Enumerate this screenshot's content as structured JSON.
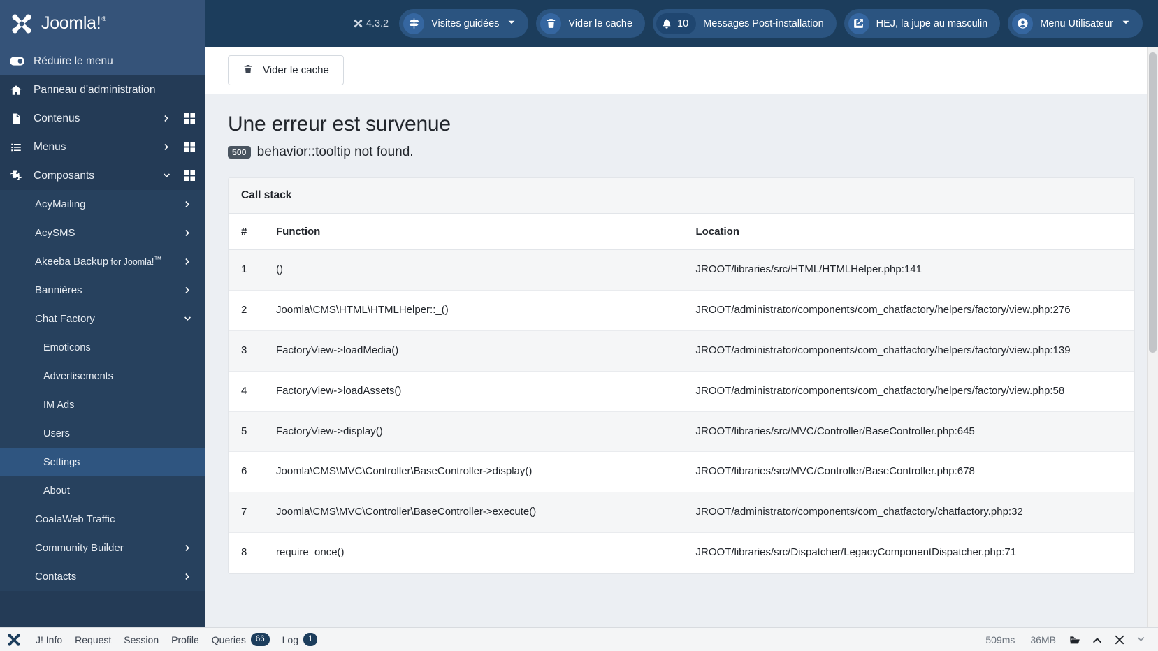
{
  "header": {
    "brand": "Joomla!",
    "brand_tm": "®",
    "version": "4.3.2",
    "buttons": {
      "guided_tours": "Visites guidées",
      "clear_cache": "Vider le cache",
      "post_install": "Messages Post-installation",
      "notifications_count": "10",
      "site_name": "HEJ, la jupe au masculin",
      "user_menu": "Menu Utilisateur"
    }
  },
  "sidebar": {
    "collapse": "Réduire le menu",
    "items": [
      {
        "label": "Panneau d'administration",
        "icon": "home-icon",
        "level": 0,
        "arrow": false,
        "grid": false,
        "active": false
      },
      {
        "label": "Contenus",
        "icon": "document-icon",
        "level": 0,
        "arrow": "right",
        "grid": true,
        "active": false
      },
      {
        "label": "Menus",
        "icon": "list-icon",
        "level": 0,
        "arrow": "right",
        "grid": true,
        "active": false
      },
      {
        "label": "Composants",
        "icon": "puzzle-icon",
        "level": 0,
        "arrow": "down",
        "grid": true,
        "active": false
      },
      {
        "label": "AcyMailing",
        "level": 1,
        "arrow": "right",
        "grid": false,
        "active": false
      },
      {
        "label": "AcySMS",
        "level": 1,
        "arrow": "right",
        "grid": false,
        "active": false
      },
      {
        "label": "Akeeba Backup",
        "label_small": " for Joomla!™",
        "level": 1,
        "arrow": "right",
        "grid": false,
        "active": false
      },
      {
        "label": "Bannières",
        "level": 1,
        "arrow": "right",
        "grid": false,
        "active": false
      },
      {
        "label": "Chat Factory",
        "level": 1,
        "arrow": "down",
        "grid": false,
        "active": false
      },
      {
        "label": "Emoticons",
        "level": 2,
        "arrow": false,
        "grid": false,
        "active": false
      },
      {
        "label": "Advertisements",
        "level": 2,
        "arrow": false,
        "grid": false,
        "active": false
      },
      {
        "label": "IM Ads",
        "level": 2,
        "arrow": false,
        "grid": false,
        "active": false
      },
      {
        "label": "Users",
        "level": 2,
        "arrow": false,
        "grid": false,
        "active": false
      },
      {
        "label": "Settings",
        "level": 2,
        "arrow": false,
        "grid": false,
        "active": true
      },
      {
        "label": "About",
        "level": 2,
        "arrow": false,
        "grid": false,
        "active": false
      },
      {
        "label": "CoalaWeb Traffic",
        "level": 1,
        "arrow": false,
        "grid": false,
        "active": false
      },
      {
        "label": "Community Builder",
        "level": 1,
        "arrow": "right",
        "grid": false,
        "active": false
      },
      {
        "label": "Contacts",
        "level": 1,
        "arrow": "right",
        "grid": false,
        "active": false
      }
    ]
  },
  "toolbar": {
    "clear_cache": "Vider le cache"
  },
  "error": {
    "title": "Une erreur est survenue",
    "code": "500",
    "message": "behavior::tooltip not found."
  },
  "call_stack": {
    "heading": "Call stack",
    "columns": {
      "num": "#",
      "function": "Function",
      "location": "Location"
    },
    "rows": [
      {
        "num": "1",
        "function": "()",
        "location": "JROOT/libraries/src/HTML/HTMLHelper.php:141"
      },
      {
        "num": "2",
        "function": "Joomla\\CMS\\HTML\\HTMLHelper::_()",
        "location": "JROOT/administrator/components/com_chatfactory/helpers/factory/view.php:276"
      },
      {
        "num": "3",
        "function": "FactoryView->loadMedia()",
        "location": "JROOT/administrator/components/com_chatfactory/helpers/factory/view.php:139"
      },
      {
        "num": "4",
        "function": "FactoryView->loadAssets()",
        "location": "JROOT/administrator/components/com_chatfactory/helpers/factory/view.php:58"
      },
      {
        "num": "5",
        "function": "FactoryView->display()",
        "location": "JROOT/libraries/src/MVC/Controller/BaseController.php:645"
      },
      {
        "num": "6",
        "function": "Joomla\\CMS\\MVC\\Controller\\BaseController->display()",
        "location": "JROOT/libraries/src/MVC/Controller/BaseController.php:678"
      },
      {
        "num": "7",
        "function": "Joomla\\CMS\\MVC\\Controller\\BaseController->execute()",
        "location": "JROOT/administrator/components/com_chatfactory/chatfactory.php:32"
      },
      {
        "num": "8",
        "function": "require_once()",
        "location": "JROOT/libraries/src/Dispatcher/LegacyComponentDispatcher.php:71"
      }
    ]
  },
  "debug_bar": {
    "items": [
      {
        "label": "J! Info",
        "badge": null
      },
      {
        "label": "Request",
        "badge": null
      },
      {
        "label": "Session",
        "badge": null
      },
      {
        "label": "Profile",
        "badge": null
      },
      {
        "label": "Queries",
        "badge": "66"
      },
      {
        "label": "Log",
        "badge": "1"
      }
    ],
    "time": "509ms",
    "memory": "36MB"
  },
  "colors": {
    "brand_dark": "#1c3d5c",
    "sidebar": "#243b56",
    "active": "#2f5580",
    "accent": "#2b5480"
  }
}
